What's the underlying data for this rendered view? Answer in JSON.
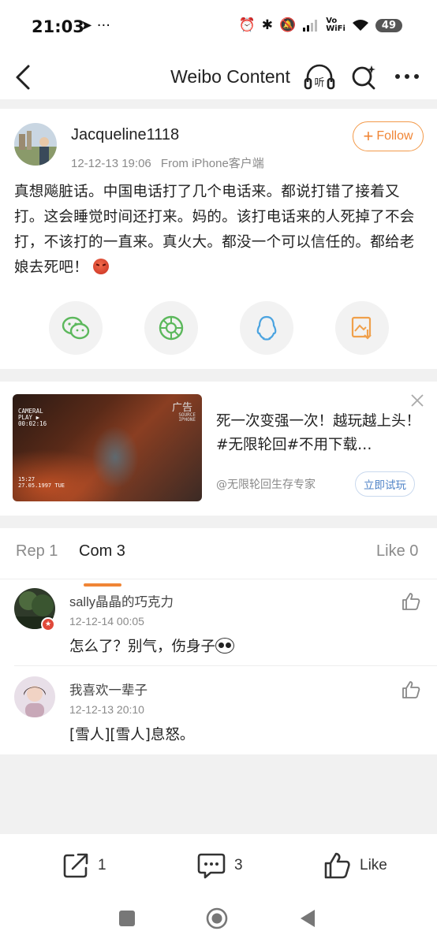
{
  "status_bar": {
    "time": "21:03",
    "left_icons": "➤ ···",
    "volte_top": "Vo",
    "volte_bottom": "WiFi",
    "battery": "49"
  },
  "nav": {
    "title": "Weibo Content",
    "listen_label": "听"
  },
  "post": {
    "username": "Jacqueline1118",
    "date": "12-12-13 19:06",
    "source": "From iPhone客户端",
    "follow_label": "Follow",
    "text": "真想飚脏话。中国电话打了几个电话来。都说打错了接着又打。这会睡觉时间还打来。妈的。该打电话来的人死掉了不会打，不该打的一直来。真火大。都没一个可以信任的。都给老娘去死吧！",
    "share_icons": [
      "wechat-icon",
      "moments-icon",
      "qq-icon",
      "save-image-icon"
    ]
  },
  "ad": {
    "tag": "广告",
    "tag_small": "SOURCE\nIPHONE",
    "cam_text": "CAMERAL\nPLAY ▶\n00:02:16",
    "date_text": "15:27\n27.05.1997 TUE",
    "title": "死一次变强一次！越玩越上头！#无限轮回#不用下载…",
    "source": "@无限轮回生存专家",
    "try_label": "立即试玩"
  },
  "tabs": {
    "reposts": "Rep 1",
    "comments": "Com 3",
    "likes": "Like 0"
  },
  "comments": [
    {
      "name": "sally晶晶的巧克力",
      "time": "12-12-14 00:05",
      "text": "怎么了？别气，伤身子"
    },
    {
      "name": "我喜欢一辈子",
      "time": "12-12-13 20:10",
      "text": "[雪人][雪人]息怒。"
    }
  ],
  "bottom": {
    "repost_count": "1",
    "comment_count": "3",
    "like_label": "Like"
  },
  "colors": {
    "accent": "#f08535",
    "link_blue": "#4f83c7",
    "wechat_green": "#5cb85c",
    "qq_blue": "#4aa3e0",
    "save_orange": "#f0a04b"
  }
}
